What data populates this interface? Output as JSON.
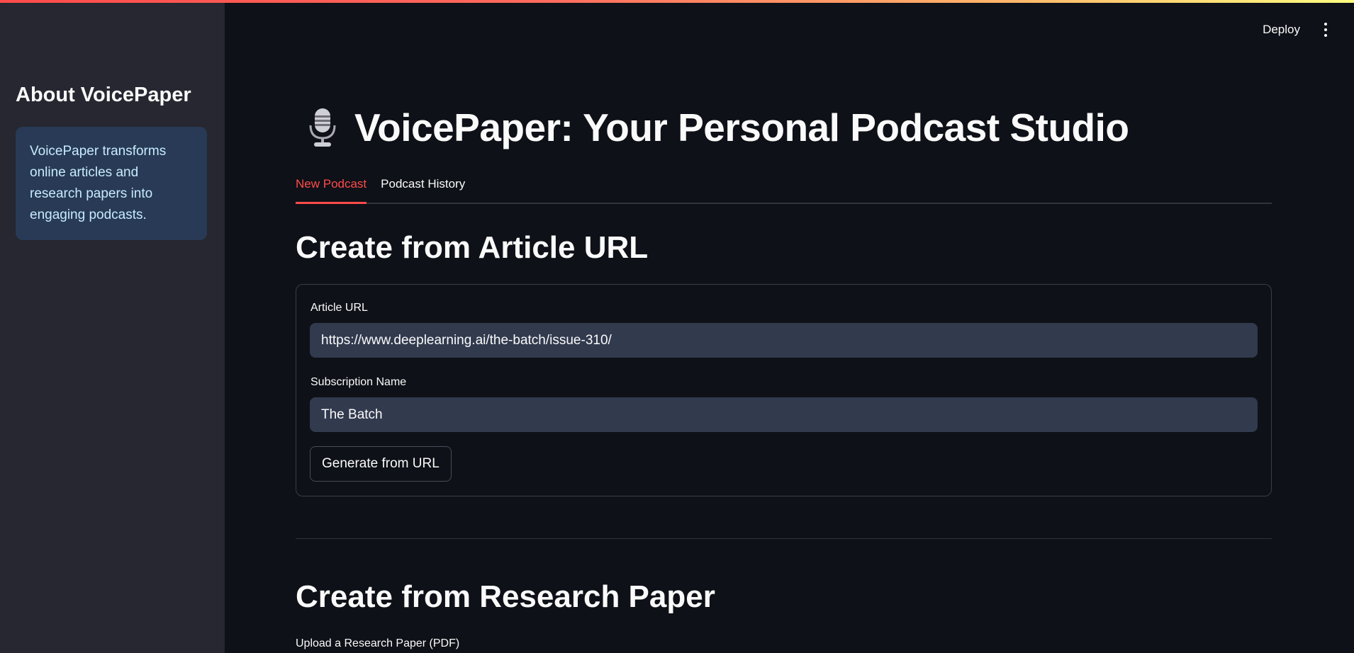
{
  "sidebar": {
    "title": "About VoicePaper",
    "info_text": "VoicePaper transforms online articles and research papers into engaging podcasts."
  },
  "header": {
    "deploy_label": "Deploy",
    "menu_icon": "kebab-menu-icon"
  },
  "page": {
    "icon": "microphone-icon",
    "title": "VoicePaper: Your Personal Podcast Studio"
  },
  "tabs": [
    {
      "label": "New Podcast",
      "active": true
    },
    {
      "label": "Podcast History",
      "active": false
    }
  ],
  "article_section": {
    "heading": "Create from Article URL",
    "url_label": "Article URL",
    "url_value": "https://www.deeplearning.ai/the-batch/issue-310/",
    "subscription_label": "Subscription Name",
    "subscription_value": "The Batch",
    "generate_button": "Generate from URL"
  },
  "paper_section": {
    "heading": "Create from Research Paper",
    "upload_label": "Upload a Research Paper (PDF)"
  },
  "colors": {
    "accent": "#ff4b4b",
    "background": "#0e1117",
    "sidebar": "#262730",
    "info_box": "#283a55"
  }
}
